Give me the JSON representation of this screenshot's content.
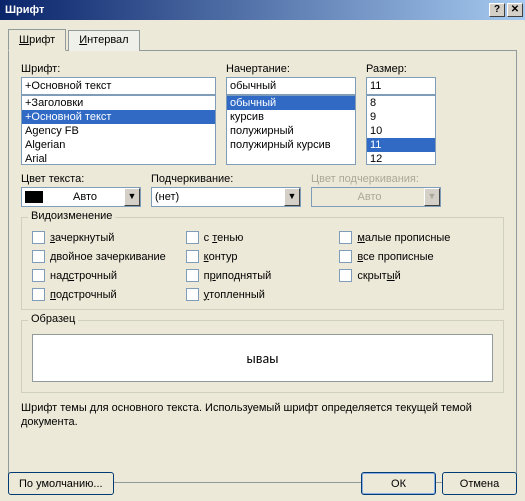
{
  "title": "Шрифт",
  "tabs": {
    "font": "Шрифт",
    "interval": "Интервал"
  },
  "labels": {
    "font": "Шрифт:",
    "style": "Начертание:",
    "size": "Размер:",
    "color": "Цвет текста:",
    "underline": "Подчеркивание:",
    "underline_color": "Цвет подчеркивания:",
    "effects_group": "Видоизменение",
    "sample_group": "Образец"
  },
  "font": {
    "value": "+Основной текст",
    "items": [
      "+Заголовки",
      "+Основной текст",
      "Agency FB",
      "Algerian",
      "Arial"
    ],
    "selected_index": 1
  },
  "style": {
    "value": "обычный",
    "items": [
      "обычный",
      "курсив",
      "полужирный",
      "полужирный курсив"
    ],
    "selected_index": 0
  },
  "size": {
    "value": "11",
    "items": [
      "8",
      "9",
      "10",
      "11",
      "12"
    ],
    "selected_index": 3
  },
  "color": {
    "value": "Авто"
  },
  "underline": {
    "value": "(нет)"
  },
  "underline_color": {
    "value": "Авто",
    "disabled": true
  },
  "effects": {
    "col1": [
      {
        "label_pre": "",
        "u": "з",
        "label_post": "ачеркнутый"
      },
      {
        "label_pre": "",
        "u": "д",
        "label_post": "войное зачеркивание"
      },
      {
        "label_pre": "над",
        "u": "с",
        "label_post": "трочный"
      },
      {
        "label_pre": "",
        "u": "п",
        "label_post": "одстрочный"
      }
    ],
    "col2": [
      {
        "label_pre": "с ",
        "u": "т",
        "label_post": "енью"
      },
      {
        "label_pre": "",
        "u": "к",
        "label_post": "онтур"
      },
      {
        "label_pre": "п",
        "u": "р",
        "label_post": "иподнятый"
      },
      {
        "label_pre": "",
        "u": "у",
        "label_post": "топленный"
      }
    ],
    "col3": [
      {
        "label_pre": "",
        "u": "м",
        "label_post": "алые прописные"
      },
      {
        "label_pre": "",
        "u": "в",
        "label_post": "се прописные"
      },
      {
        "label_pre": "скрыт",
        "u": "ы",
        "label_post": "й"
      }
    ]
  },
  "sample_text": "ываы",
  "hint": "Шрифт темы для основного текста. Используемый шрифт определяется текущей темой документа.",
  "buttons": {
    "default": "По умолчанию...",
    "ok": "ОК",
    "cancel": "Отмена"
  }
}
